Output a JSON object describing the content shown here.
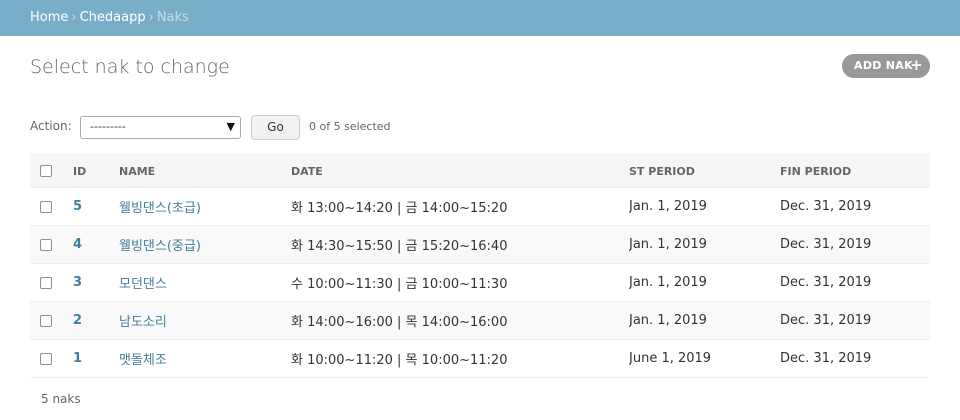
{
  "breadcrumbs": {
    "home": "Home",
    "app": "Chedaapp",
    "current": "Naks",
    "separator": "›"
  },
  "title": "Select nak to change",
  "add_button": {
    "label": "ADD NAK",
    "icon": "plus-icon"
  },
  "actions": {
    "label": "Action:",
    "selected_option": "---------",
    "go_label": "Go",
    "selection_count": "0 of 5 selected"
  },
  "table": {
    "headers": {
      "id": "ID",
      "name": "NAME",
      "date": "DATE",
      "st_period": "ST PERIOD",
      "fin_period": "FIN PERIOD"
    },
    "rows": [
      {
        "id": "5",
        "name": "웰빙댄스(초급)",
        "date": "화 13:00~14:20 | 금 14:00~15:20",
        "st_period": "Jan. 1, 2019",
        "fin_period": "Dec. 31, 2019"
      },
      {
        "id": "4",
        "name": "웰빙댄스(중급)",
        "date": "화 14:30~15:50 | 금 15:20~16:40",
        "st_period": "Jan. 1, 2019",
        "fin_period": "Dec. 31, 2019"
      },
      {
        "id": "3",
        "name": "모던댄스",
        "date": "수 10:00~11:30 | 금 10:00~11:30",
        "st_period": "Jan. 1, 2019",
        "fin_period": "Dec. 31, 2019"
      },
      {
        "id": "2",
        "name": "남도소리",
        "date": "화 14:00~16:00 | 목 14:00~16:00",
        "st_period": "Jan. 1, 2019",
        "fin_period": "Dec. 31, 2019"
      },
      {
        "id": "1",
        "name": "맷돌체조",
        "date": "화 10:00~11:20 | 목 10:00~11:20",
        "st_period": "June 1, 2019",
        "fin_period": "Dec. 31, 2019"
      }
    ]
  },
  "paginator": "5 naks",
  "colors": {
    "header_bar": "#79aec8",
    "link": "#447e9b",
    "add_button": "#999999"
  }
}
